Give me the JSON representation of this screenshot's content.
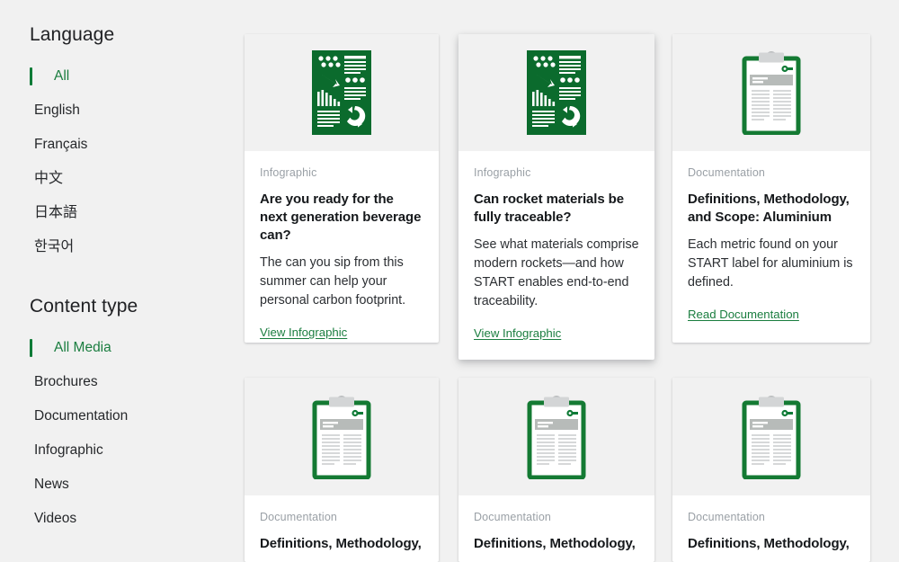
{
  "colors": {
    "accent_green": "#0f7b37",
    "link_green": "#1a7d3f",
    "icon_green": "#0b6b2d",
    "page_bg": "#f1f1f1",
    "card_bg": "#ffffff",
    "kicker_gray": "#9aa0a6"
  },
  "sidebar": {
    "facets": [
      {
        "title": "Language",
        "name": "language",
        "items": [
          {
            "label": "All",
            "active": true,
            "cjk": false
          },
          {
            "label": "English",
            "active": false,
            "cjk": false
          },
          {
            "label": "Français",
            "active": false,
            "cjk": false
          },
          {
            "label": "中文",
            "active": false,
            "cjk": true
          },
          {
            "label": "日本語",
            "active": false,
            "cjk": true
          },
          {
            "label": "한국어",
            "active": false,
            "cjk": true
          }
        ]
      },
      {
        "title": "Content type",
        "name": "content-type",
        "items": [
          {
            "label": "All Media",
            "active": true,
            "cjk": false
          },
          {
            "label": "Brochures",
            "active": false,
            "cjk": false
          },
          {
            "label": "Documentation",
            "active": false,
            "cjk": false
          },
          {
            "label": "Infographic",
            "active": false,
            "cjk": false
          },
          {
            "label": "News",
            "active": false,
            "cjk": false
          },
          {
            "label": "Videos",
            "active": false,
            "cjk": false
          }
        ]
      }
    ]
  },
  "grid": {
    "cards": [
      {
        "icon": "infographic-icon",
        "kicker": "Infographic",
        "title": "Are you ready for the next generation beverage can?",
        "desc": "The can you sip from this summer can help your personal carbon footprint.",
        "link": "View Infographic"
      },
      {
        "icon": "infographic-icon",
        "kicker": "Infographic",
        "title": "Can rocket materials be fully traceable?",
        "desc": "See what materials comprise modern rockets—and how START enables end-to-end traceability.",
        "link": "View Infographic"
      },
      {
        "icon": "clipboard-document-icon",
        "kicker": "Documentation",
        "title": "Definitions, Methodology, and Scope: Aluminium",
        "desc": "Each metric found on your START label for aluminium is defined.",
        "link": "Read Documentation"
      },
      {
        "icon": "clipboard-document-icon",
        "kicker": "Documentation",
        "title": "Definitions, Methodology,",
        "desc": "",
        "link": ""
      },
      {
        "icon": "clipboard-document-icon",
        "kicker": "Documentation",
        "title": "Definitions, Methodology,",
        "desc": "",
        "link": ""
      },
      {
        "icon": "clipboard-document-icon",
        "kicker": "Documentation",
        "title": "Definitions, Methodology,",
        "desc": "",
        "link": ""
      }
    ]
  }
}
